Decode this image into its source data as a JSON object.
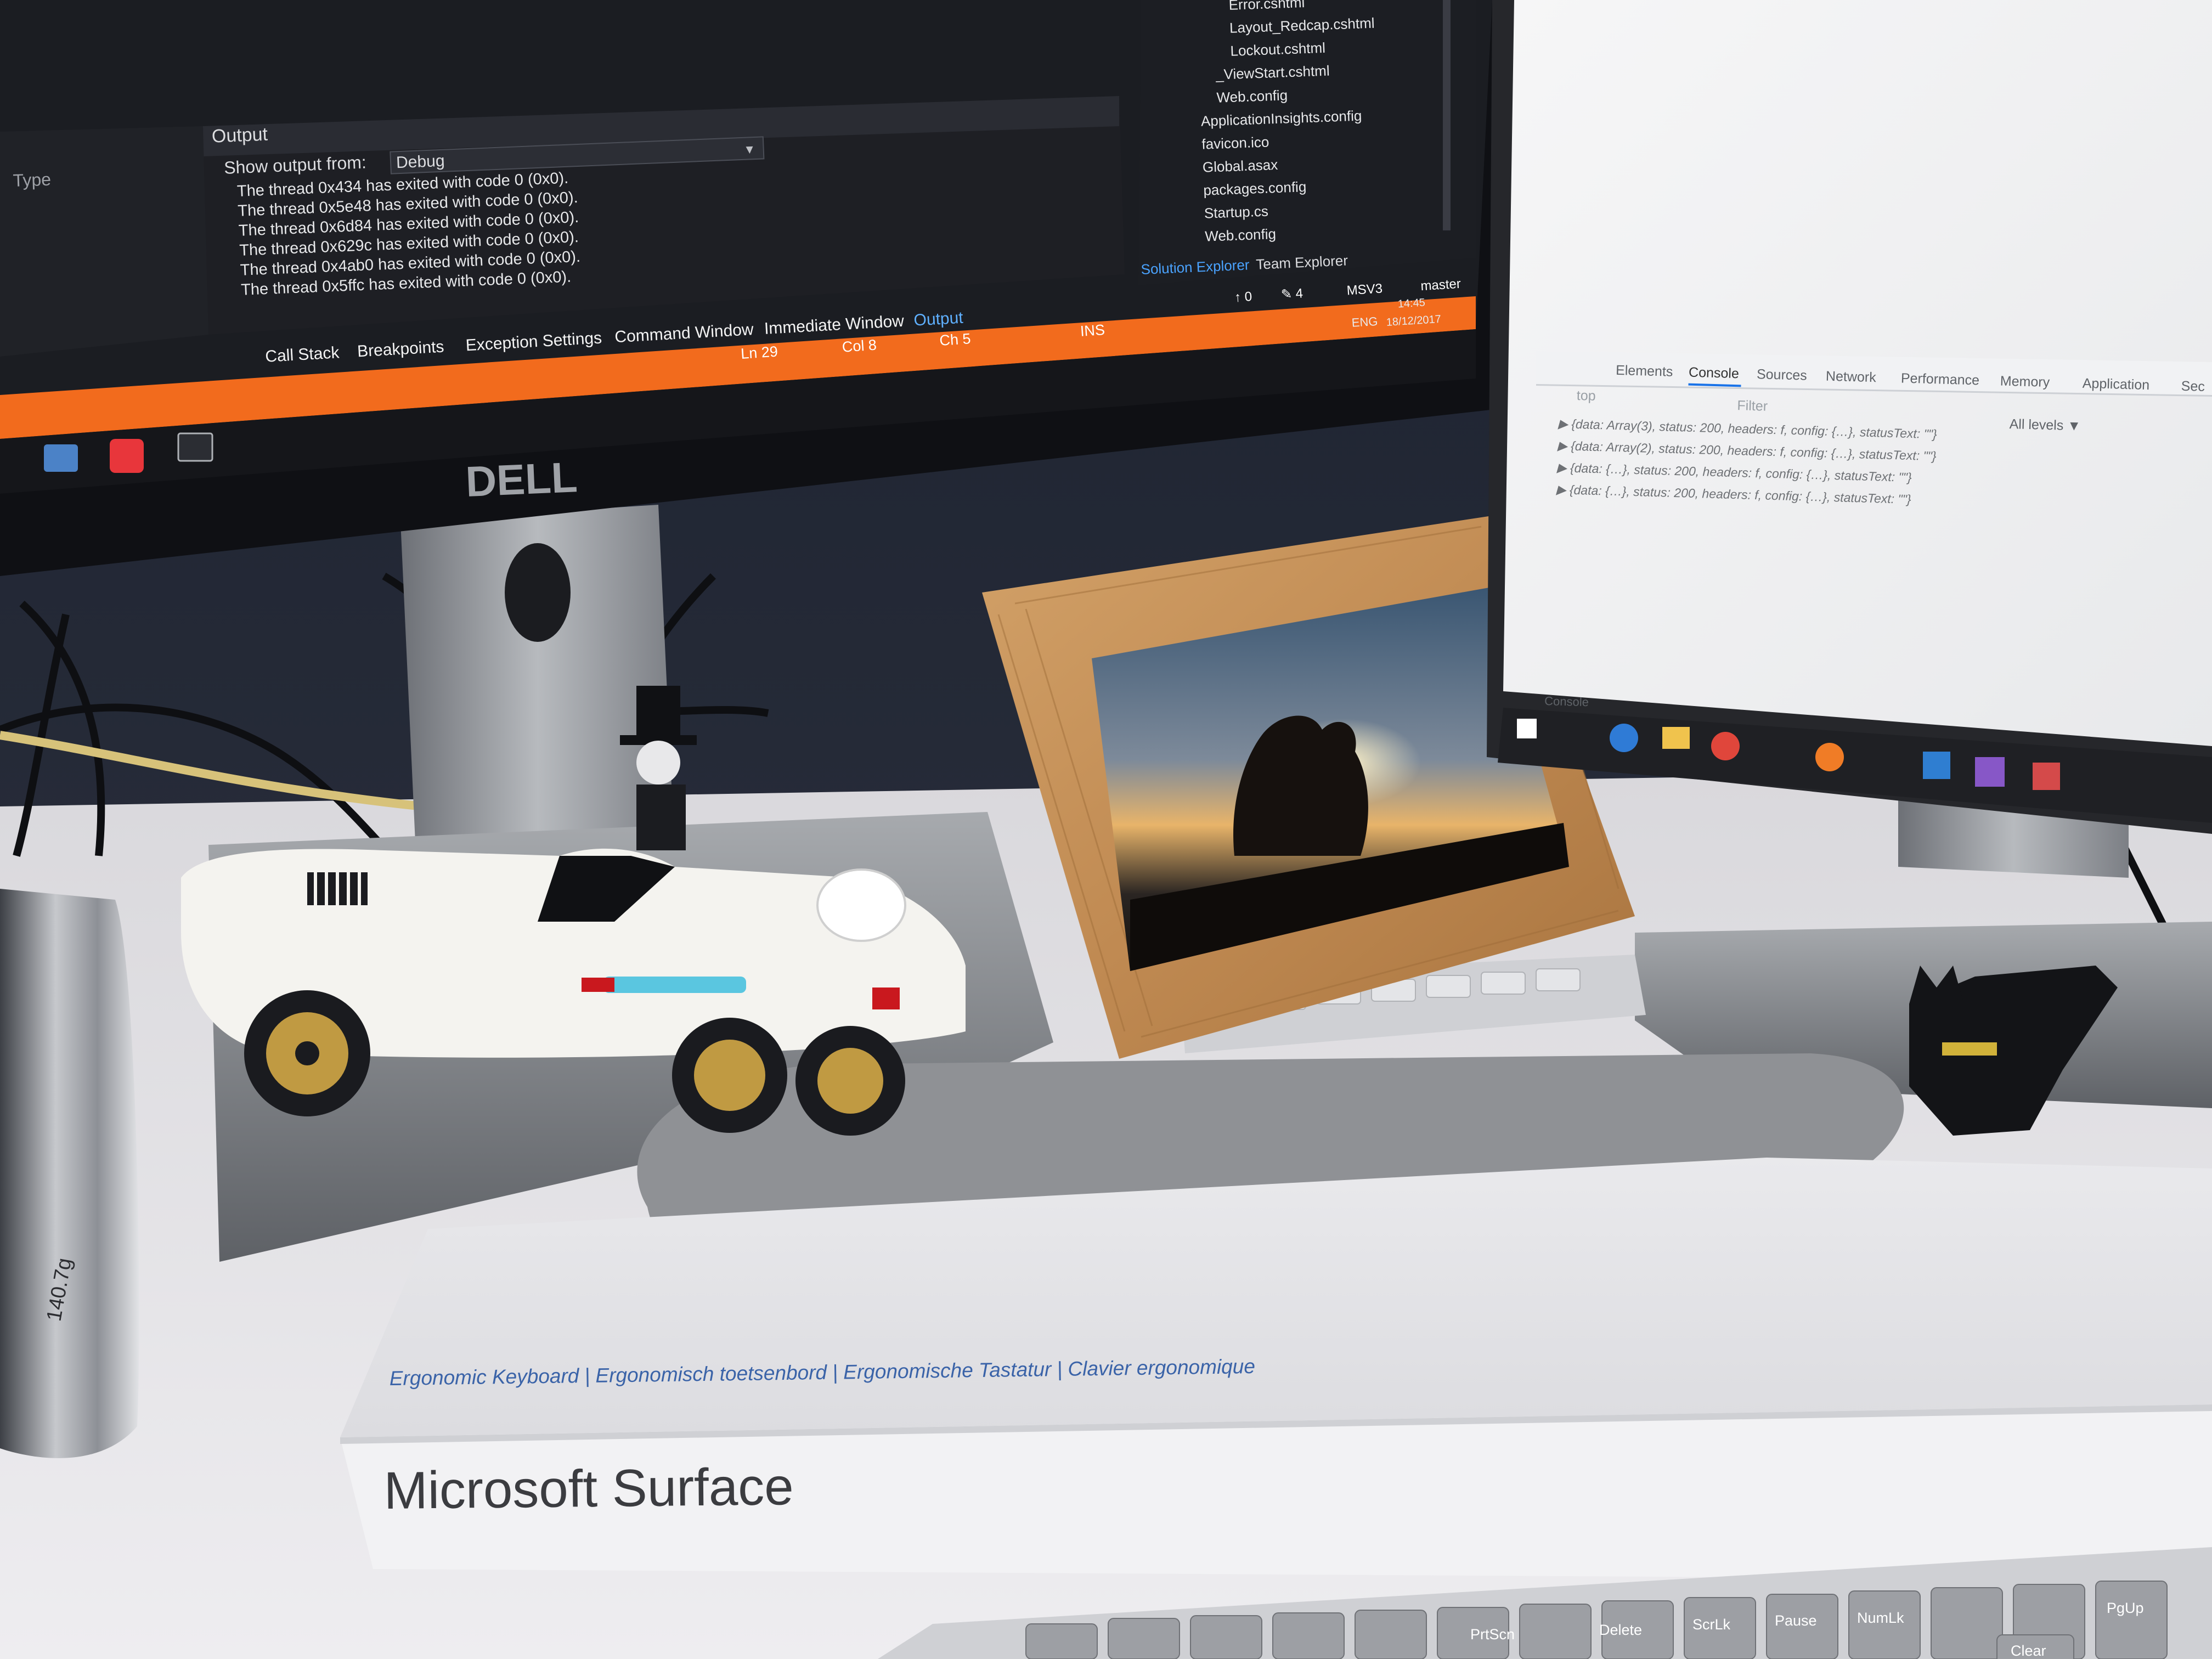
{
  "left_monitor": {
    "brand": "DELL",
    "vs": {
      "output_panel": {
        "title": "Output",
        "show_output_from_label": "Show output from:",
        "source_value": "Debug",
        "lines": [
          "The thread 0x434 has exited with code 0 (0x0).",
          "The thread 0x5e48 has exited with code 0 (0x0).",
          "The thread 0x6d84 has exited with code 0 (0x0).",
          "The thread 0x629c has exited with code 0 (0x0).",
          "The thread 0x4ab0 has exited with code 0 (0x0).",
          "The thread 0x5ffc has exited with code 0 (0x0)."
        ]
      },
      "properties_panel": {
        "column_label": "Type"
      },
      "bottom_tabs": [
        "Call Stack",
        "Breakpoints",
        "Exception Settings",
        "Command Window",
        "Immediate Window",
        "Output"
      ],
      "solution_explorer": {
        "items": [
          "Error.cshtml",
          "Layout_Redcap.cshtml",
          "Lockout.cshtml",
          "_ViewStart.cshtml",
          "Web.config",
          "ApplicationInsights.config",
          "favicon.ico",
          "Global.asax",
          "packages.config",
          "Startup.cs",
          "Web.config"
        ],
        "tabs": [
          "Solution Explorer",
          "Team Explorer"
        ]
      },
      "status_bar": {
        "ln": "Ln 29",
        "col": "Col 8",
        "ch": "Ch 5",
        "mode": "INS",
        "pending": "↑ 0",
        "edits": "✎ 4",
        "project": "MSV3",
        "branch": "master"
      },
      "accent_color": "#f26b1d"
    },
    "tray": {
      "language": "ENG",
      "time": "14:45",
      "date": "18/12/2017"
    }
  },
  "right_monitor": {
    "devtools_tabs": [
      "Elements",
      "Console",
      "Sources",
      "Network",
      "Performance",
      "Memory",
      "Application",
      "Sec"
    ],
    "context": "top",
    "filter_placeholder": "Filter",
    "level_filter": "All levels ▼",
    "console_lines": [
      "▶ {data: Array(3), status: 200, headers: f, config: {…}, statusText: \"\"}",
      "▶ {data: Array(2), status: 200, headers: f, config: {…}, statusText: \"\"}",
      "▶ {data: {…}, status: 200, headers: f, config: {…}, statusText: \"\"}",
      "▶ {data: {…}, status: 200, headers: f, config: {…}, statusText: \"\"}"
    ],
    "drawer_tab": "Console"
  },
  "keyboard_box": {
    "subtitle": "Ergonomic Keyboard  |  Ergonomisch toetsenbord  |  Ergonomische Tastatur  |  Clavier ergonomique",
    "brand": "Microsoft Surface"
  },
  "keyboard_keys": [
    "PrtScn",
    "Delete",
    "ScrLk",
    "Pause",
    "NumLk",
    "PgUp",
    "Clear"
  ],
  "mug_label": "140.7g"
}
